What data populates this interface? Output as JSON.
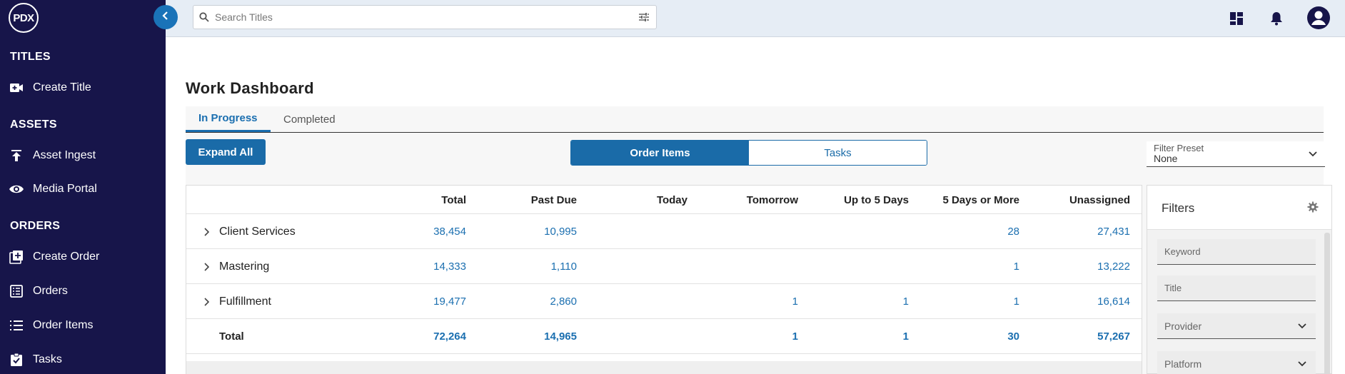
{
  "brand": {
    "logo_text": "PDX"
  },
  "sidebar": {
    "sections": [
      {
        "title": "TITLES",
        "items": [
          {
            "label": "Create Title",
            "icon": "video-add-icon"
          }
        ]
      },
      {
        "title": "ASSETS",
        "items": [
          {
            "label": "Asset Ingest",
            "icon": "upload-icon"
          },
          {
            "label": "Media Portal",
            "icon": "eye-icon"
          }
        ]
      },
      {
        "title": "ORDERS",
        "items": [
          {
            "label": "Create Order",
            "icon": "add-box-icon"
          },
          {
            "label": "Orders",
            "icon": "list-box-icon"
          },
          {
            "label": "Order Items",
            "icon": "list-icon"
          },
          {
            "label": "Tasks",
            "icon": "clipboard-check-icon"
          }
        ]
      }
    ]
  },
  "search": {
    "placeholder": "Search Titles"
  },
  "page": {
    "title": "Work Dashboard",
    "tabs": [
      {
        "label": "In Progress",
        "active": true
      },
      {
        "label": "Completed",
        "active": false
      }
    ],
    "expand_all_label": "Expand All",
    "view_toggle": [
      {
        "label": "Order Items",
        "active": true
      },
      {
        "label": "Tasks",
        "active": false
      }
    ],
    "filter_preset": {
      "label": "Filter Preset",
      "value": "None"
    }
  },
  "table": {
    "columns": [
      "Total",
      "Past Due",
      "Today",
      "Tomorrow",
      "Up to 5 Days",
      "5 Days or More",
      "Unassigned"
    ],
    "rows": [
      {
        "name": "Client Services",
        "values": [
          "38,454",
          "10,995",
          "",
          "",
          "",
          "28",
          "27,431"
        ]
      },
      {
        "name": "Mastering",
        "values": [
          "14,333",
          "1,110",
          "",
          "",
          "",
          "1",
          "13,222"
        ]
      },
      {
        "name": "Fulfillment",
        "values": [
          "19,477",
          "2,860",
          "",
          "1",
          "1",
          "1",
          "16,614"
        ]
      }
    ],
    "total": {
      "name": "Total",
      "values": [
        "72,264",
        "14,965",
        "",
        "1",
        "1",
        "30",
        "57,267"
      ]
    }
  },
  "filters": {
    "title": "Filters",
    "fields": [
      {
        "placeholder": "Keyword",
        "type": "text"
      },
      {
        "placeholder": "Title",
        "type": "text"
      },
      {
        "label": "Provider",
        "type": "select"
      },
      {
        "label": "Platform",
        "type": "select"
      }
    ]
  },
  "colors": {
    "sidebar": "#17154a",
    "accent": "#1a6ba8",
    "link": "#1b6fb0",
    "topbar": "#e6edf5"
  }
}
